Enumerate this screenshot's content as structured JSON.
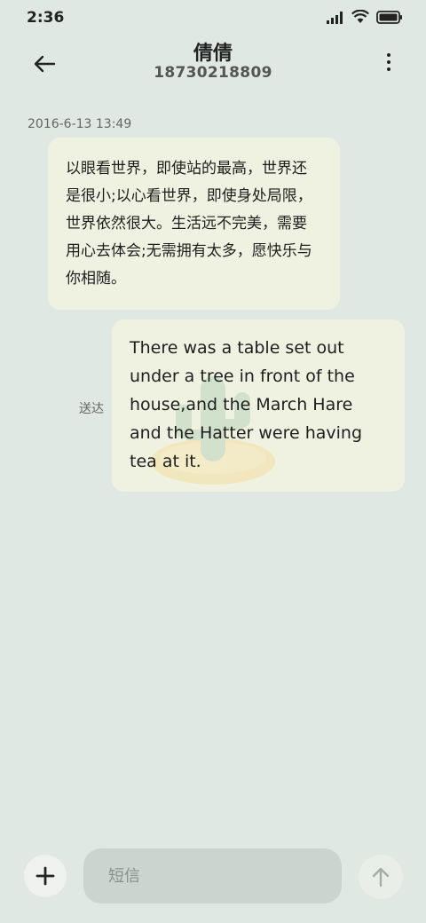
{
  "status_bar": {
    "time": "2:36",
    "icons": [
      "signal-icon",
      "wifi-icon",
      "battery-icon"
    ]
  },
  "header": {
    "contact_name": "倩倩",
    "contact_number": "18730218809"
  },
  "conversation": {
    "timestamp": "2016-6-13 13:49",
    "messages": [
      {
        "direction": "received",
        "text": "以眼看世界，即使站的最高，世界还是很小;以心看世界，即使身处局限，世界依然很大。生活远不完美，需要用心去体会;无需拥有太多，愿快乐与你相随。"
      },
      {
        "direction": "sent",
        "text": "There was a table set out under a tree in front of the house,and the March Hare and the Hatter were having tea at it.",
        "status": "送达"
      }
    ]
  },
  "composer": {
    "placeholder": "短信",
    "value": ""
  },
  "colors": {
    "background": "#dfe8e3",
    "bubble": "#f0f2e1",
    "input": "#cbd5cf"
  }
}
